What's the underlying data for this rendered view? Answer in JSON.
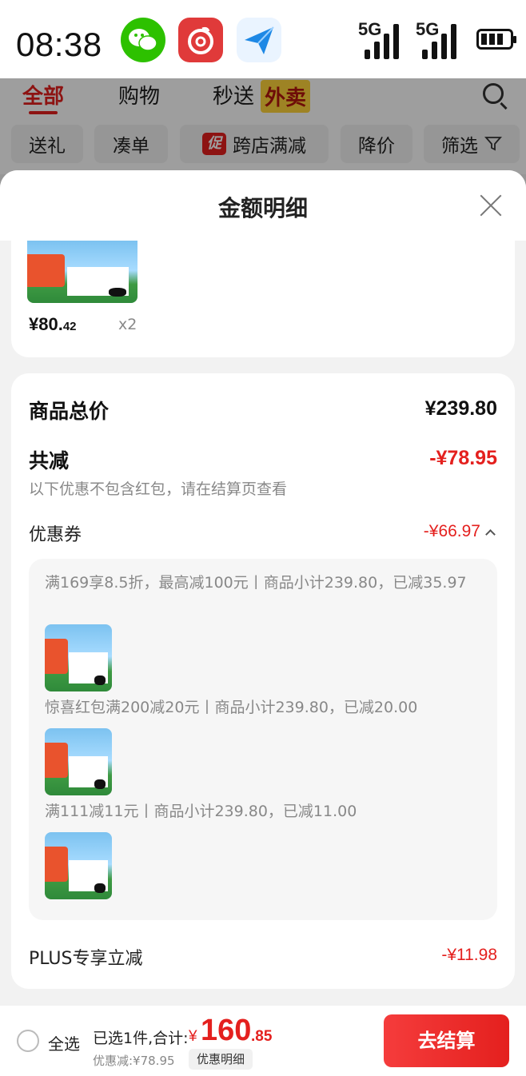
{
  "status_bar": {
    "time": "08:38",
    "signal1": "5G",
    "signal2": "5G"
  },
  "background_page": {
    "nav_tabs": [
      "全部",
      "购物",
      "秒送"
    ],
    "waimai_badge": "外卖",
    "chips": [
      "送礼",
      "凑单",
      "跨店满减",
      "降价",
      "筛选"
    ],
    "promo_badge": "促"
  },
  "sheet": {
    "title": "金额明细",
    "product": {
      "price_int": "¥80.",
      "price_dec": "42",
      "qty": "x2"
    },
    "rows": {
      "total_label": "商品总价",
      "total_value": "¥239.80",
      "reduce_label": "共减",
      "reduce_value": "-¥78.95",
      "reduce_note": "以下优惠不包含红包，请在结算页查看",
      "coupon_label": "优惠券",
      "coupon_value": "-¥66.97",
      "plus_label": "PLUS专享立减",
      "plus_value": "-¥11.98"
    },
    "coupons": [
      {
        "text": "满169享8.5折，最高减100元丨商品小计239.80，已减35.97"
      },
      {
        "text": "惊喜红包满200减20元丨商品小计239.80，已减20.00"
      },
      {
        "text": "满111减11元丨商品小计239.80，已减11.00"
      }
    ]
  },
  "bottom_bar": {
    "select_all": "全选",
    "summary": "已选1件,合计:",
    "yen": "¥",
    "total_int": "160",
    "total_dec": ".85",
    "discount": "优惠减:¥78.95",
    "detail_button": "优惠明细",
    "checkout_button": "去结算"
  },
  "colors": {
    "accent": "#e4201e",
    "overlay": "rgba(0,0,0,0.38)"
  }
}
